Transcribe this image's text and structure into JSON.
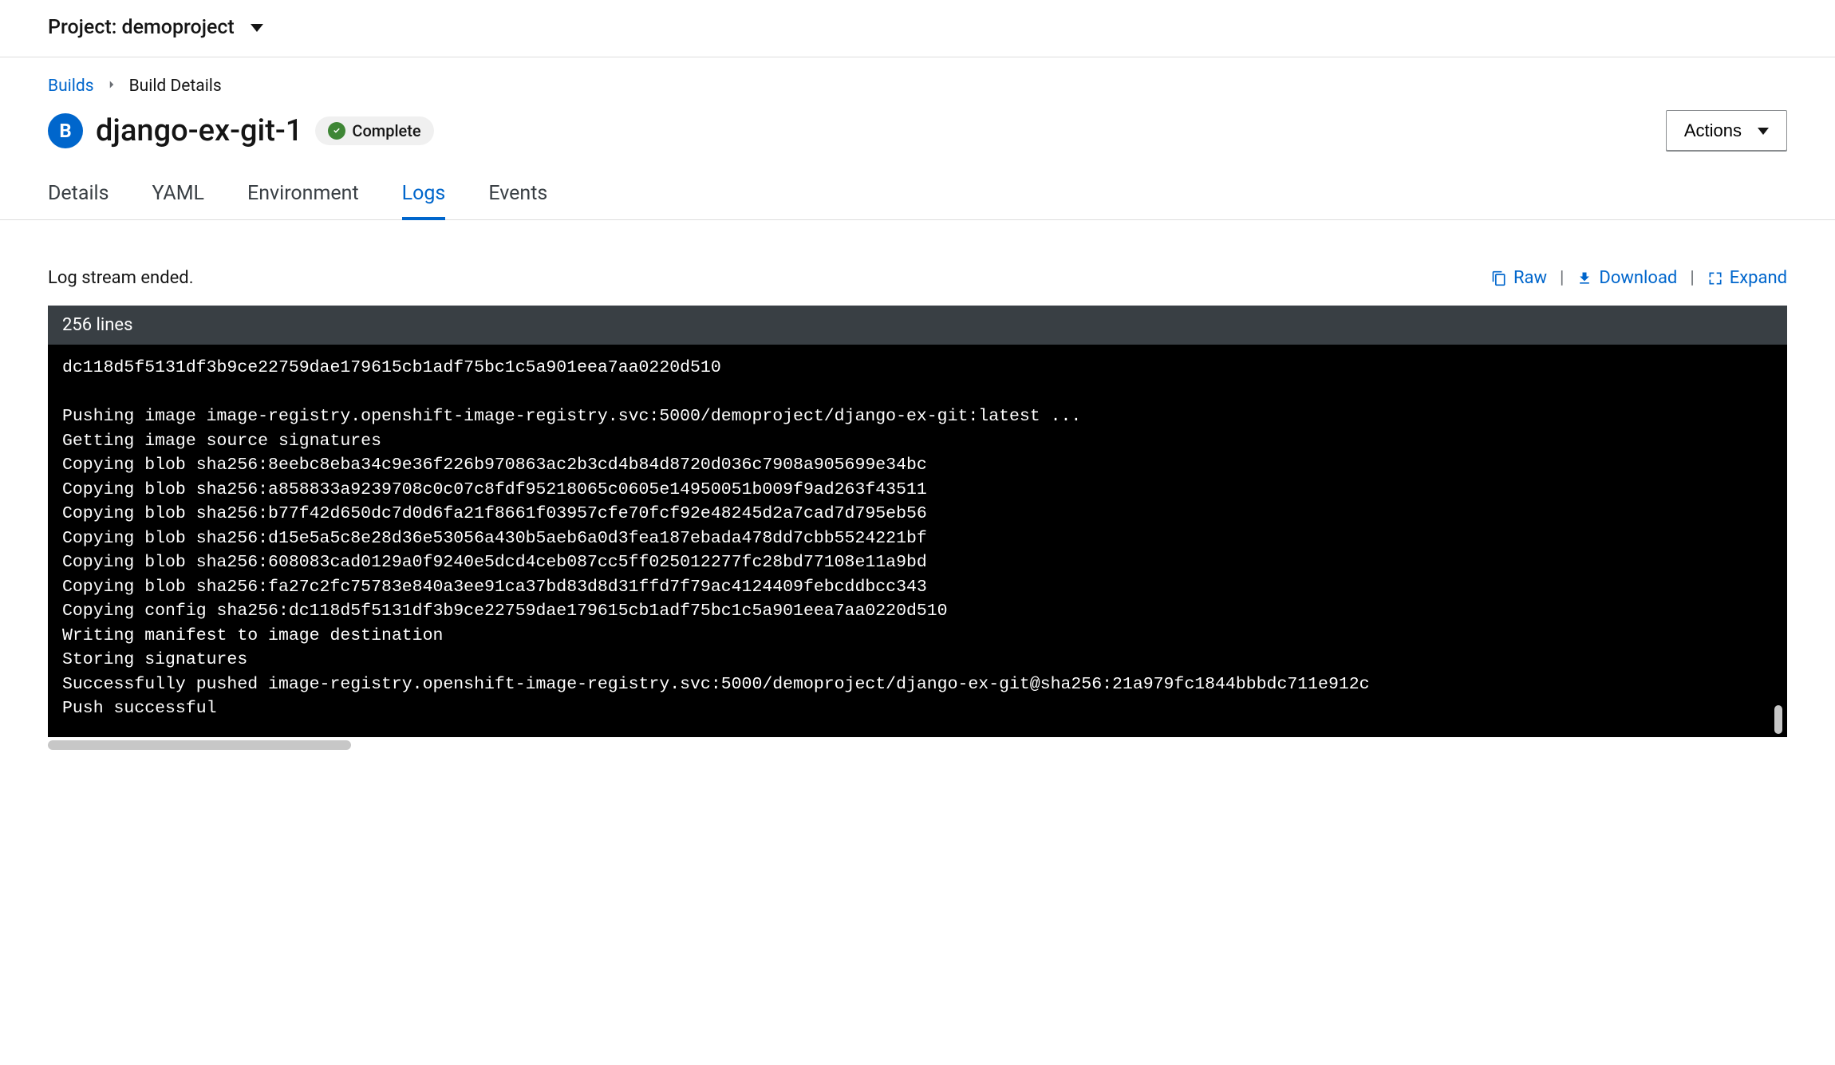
{
  "project": {
    "prefix": "Project:",
    "name": "demoproject"
  },
  "breadcrumb": {
    "root": "Builds",
    "current": "Build Details"
  },
  "title": {
    "badge": "B",
    "text": "django-ex-git-1",
    "status": "Complete"
  },
  "actions": {
    "label": "Actions"
  },
  "tabs": {
    "details": "Details",
    "yaml": "YAML",
    "environment": "Environment",
    "logs": "Logs",
    "events": "Events"
  },
  "logs": {
    "status": "Log stream ended.",
    "raw": "Raw",
    "download": "Download",
    "expand": "Expand",
    "lineCount": "256 lines",
    "body": "dc118d5f5131df3b9ce22759dae179615cb1adf75bc1c5a901eea7aa0220d510\n\nPushing image image-registry.openshift-image-registry.svc:5000/demoproject/django-ex-git:latest ...\nGetting image source signatures\nCopying blob sha256:8eebc8eba34c9e36f226b970863ac2b3cd4b84d8720d036c7908a905699e34bc\nCopying blob sha256:a858833a9239708c0c07c8fdf95218065c0605e14950051b009f9ad263f43511\nCopying blob sha256:b77f42d650dc7d0d6fa21f8661f03957cfe70fcf92e48245d2a7cad7d795eb56\nCopying blob sha256:d15e5a5c8e28d36e53056a430b5aeb6a0d3fea187ebada478dd7cbb5524221bf\nCopying blob sha256:608083cad0129a0f9240e5dcd4ceb087cc5ff025012277fc28bd77108e11a9bd\nCopying blob sha256:fa27c2fc75783e840a3ee91ca37bd83d8d31ffd7f79ac4124409febcddbcc343\nCopying config sha256:dc118d5f5131df3b9ce22759dae179615cb1adf75bc1c5a901eea7aa0220d510\nWriting manifest to image destination\nStoring signatures\nSuccessfully pushed image-registry.openshift-image-registry.svc:5000/demoproject/django-ex-git@sha256:21a979fc1844bbbdc711e912c\nPush successful"
  }
}
